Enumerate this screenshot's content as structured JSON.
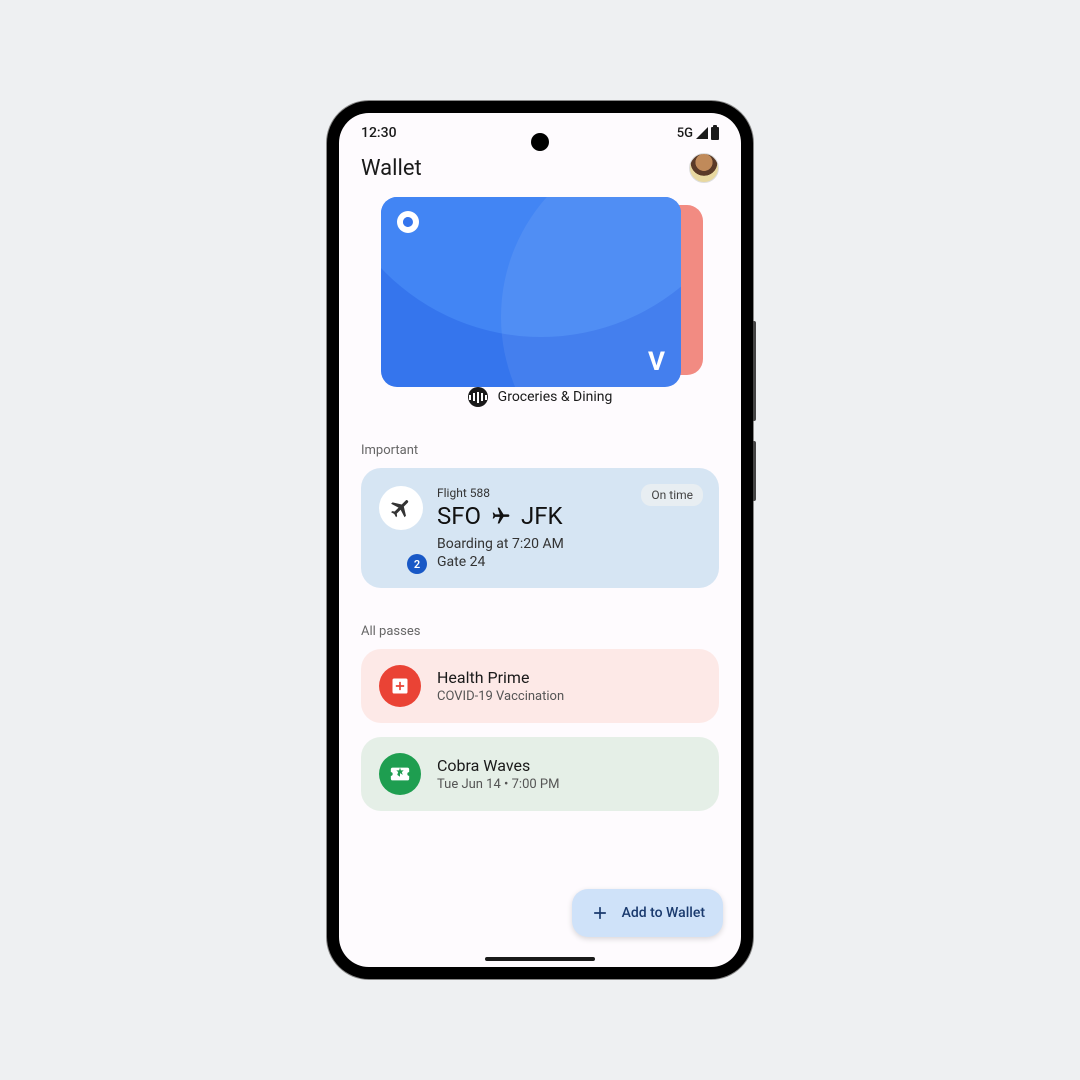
{
  "status": {
    "time": "12:30",
    "network": "5G"
  },
  "header": {
    "title": "Wallet"
  },
  "card": {
    "label": "Groceries & Dining"
  },
  "important": {
    "section_label": "Important",
    "flight_label": "Flight 588",
    "origin": "SFO",
    "destination": "JFK",
    "status": "On time",
    "boarding": "Boarding at 7:20 AM",
    "gate": "Gate 24",
    "badge": "2"
  },
  "passes": {
    "section_label": "All passes",
    "items": [
      {
        "title": "Health Prime",
        "subtitle": "COVID-19 Vaccination"
      },
      {
        "title": "Cobra Waves",
        "subtitle": "Tue Jun 14 • 7:00 PM"
      }
    ]
  },
  "fab": {
    "label": "Add to Wallet"
  }
}
